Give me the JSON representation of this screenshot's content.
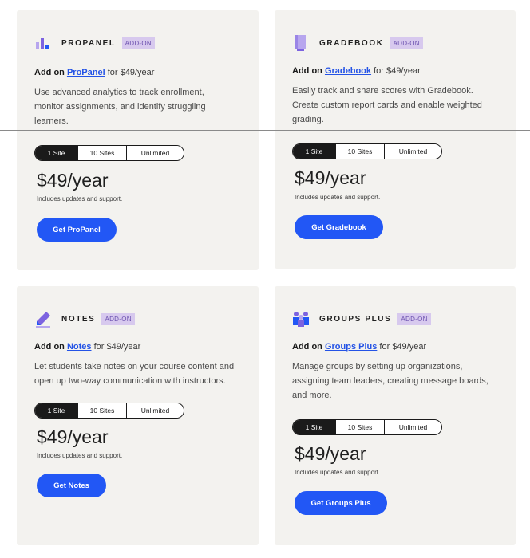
{
  "accent": "#2257f5",
  "badge_color": "#d7c9ee",
  "cards": [
    {
      "name": "PROPANEL",
      "badge": "ADD-ON",
      "addon_prefix": "Add on",
      "addon_link": "ProPanel",
      "addon_suffix": "for $49/year",
      "description": "Use advanced analytics to track enrollment, monitor assignments, and identify struggling learners.",
      "tabs": [
        "1 Site",
        "10 Sites",
        "Unlimited"
      ],
      "price": "$49/year",
      "includes": "Includes updates and support.",
      "button": "Get ProPanel",
      "icon": "bar-chart-icon"
    },
    {
      "name": "GRADEBOOK",
      "badge": "ADD-ON",
      "addon_prefix": "Add on",
      "addon_link": "Gradebook",
      "addon_suffix": "for $49/year",
      "description": "Easily track and share scores with Gradebook. Create custom report cards and enable weighted grading.",
      "tabs": [
        "1 Site",
        "10 Sites",
        "Unlimited"
      ],
      "price": "$49/year",
      "includes": "Includes updates and support.",
      "button": "Get Gradebook",
      "icon": "book-icon"
    },
    {
      "name": "NOTES",
      "badge": "ADD-ON",
      "addon_prefix": "Add on",
      "addon_link": "Notes",
      "addon_suffix": "for $49/year",
      "description": "Let students take notes on your course content and open up two-way communication with instructors.",
      "tabs": [
        "1 Site",
        "10 Sites",
        "Unlimited"
      ],
      "price": "$49/year",
      "includes": "Includes updates and support.",
      "button": "Get Notes",
      "icon": "pencil-icon"
    },
    {
      "name": "GROUPS PLUS",
      "badge": "ADD-ON",
      "addon_prefix": "Add on",
      "addon_link": "Groups Plus",
      "addon_suffix": "for $49/year",
      "description": "Manage groups by setting up organizations, assigning team leaders, creating message boards, and more.",
      "tabs": [
        "1 Site",
        "10 Sites",
        "Unlimited"
      ],
      "price": "$49/year",
      "includes": "Includes updates and support.",
      "button": "Get Groups Plus",
      "icon": "group-icon"
    }
  ]
}
